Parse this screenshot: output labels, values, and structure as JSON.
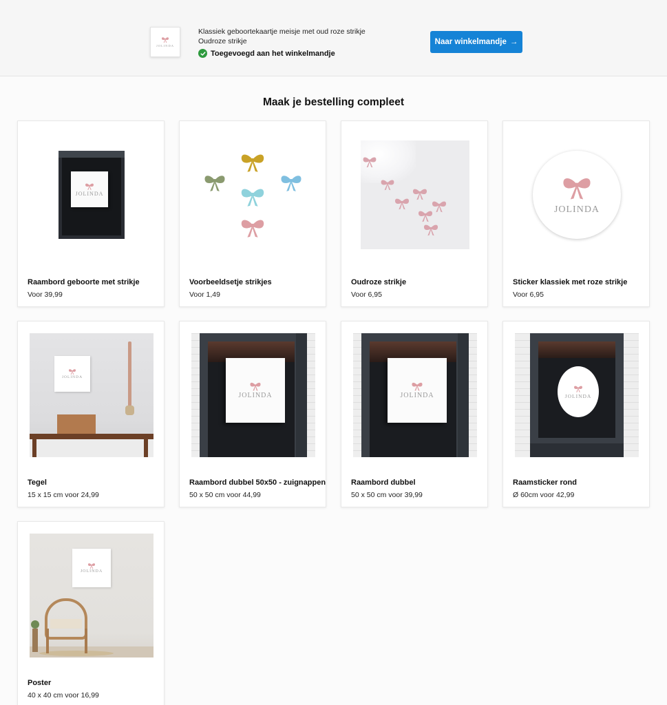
{
  "confirmation": {
    "product_title": "Klassiek geboortekaartje meisje met oud roze strikje",
    "variant": "Oudroze strikje",
    "status": "Toegevoegd aan het winkelmandje",
    "cart_button_label": "Naar winkelmandje",
    "button_arrow": "→",
    "accent_color": "#1583d6",
    "status_color": "#2e9a3e",
    "icons": {
      "status": "check-circle-icon",
      "button": "arrow-right-icon"
    }
  },
  "section": {
    "title": "Maak je bestelling compleet"
  },
  "products": [
    {
      "name": "Raambord geboorte met strikje",
      "price": "Voor 39,99"
    },
    {
      "name": "Voorbeeldsetje strikjes",
      "price": "Voor 1,49"
    },
    {
      "name": "Oudroze strikje",
      "price": "Voor 6,95"
    },
    {
      "name": "Sticker klassiek met roze strikje",
      "price": "Voor 6,95"
    },
    {
      "name": "Tegel",
      "price": "15 x 15 cm voor 24,99"
    },
    {
      "name": "Raambord dubbel 50x50 - zuignappen",
      "price": "50 x 50 cm voor 44,99"
    },
    {
      "name": "Raambord dubbel",
      "price": "50 x 50 cm voor 39,99"
    },
    {
      "name": "Raamsticker rond",
      "price": "Ø 60cm voor 42,99"
    },
    {
      "name": "Poster",
      "price": "40 x 40 cm voor 16,99"
    }
  ],
  "brand_wordmark": "JOLINDA",
  "bow_colors": {
    "rose": "#dd9ea3",
    "gold": "#c9a227",
    "sage": "#8a9a6f",
    "aqua": "#8fd2dc",
    "sky": "#7fbfe0"
  }
}
